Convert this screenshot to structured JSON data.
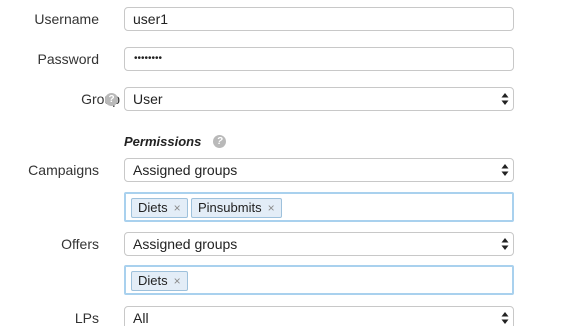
{
  "form": {
    "username": {
      "label": "Username",
      "value": "user1"
    },
    "password": {
      "label": "Password",
      "value": "••••••••"
    },
    "group": {
      "label": "Group",
      "value": "User"
    },
    "permissions_title": "Permissions",
    "campaigns": {
      "label": "Campaigns",
      "value": "Assigned groups",
      "tags": [
        "Diets",
        "Pinsubmits"
      ]
    },
    "offers": {
      "label": "Offers",
      "value": "Assigned groups",
      "tags": [
        "Diets"
      ]
    },
    "lps": {
      "label": "LPs",
      "value": "All"
    }
  },
  "icons": {
    "help": "help-icon",
    "select_arrows": "updown-arrows-icon",
    "remove": "remove-tag-icon"
  },
  "glyphs": {
    "help": "?",
    "remove": "×"
  },
  "colors": {
    "tag_border": "#9ec1dc",
    "tag_background": "#e3edf7",
    "focus_border": "#a9d1ee",
    "help_icon": "#b9b9b9"
  }
}
